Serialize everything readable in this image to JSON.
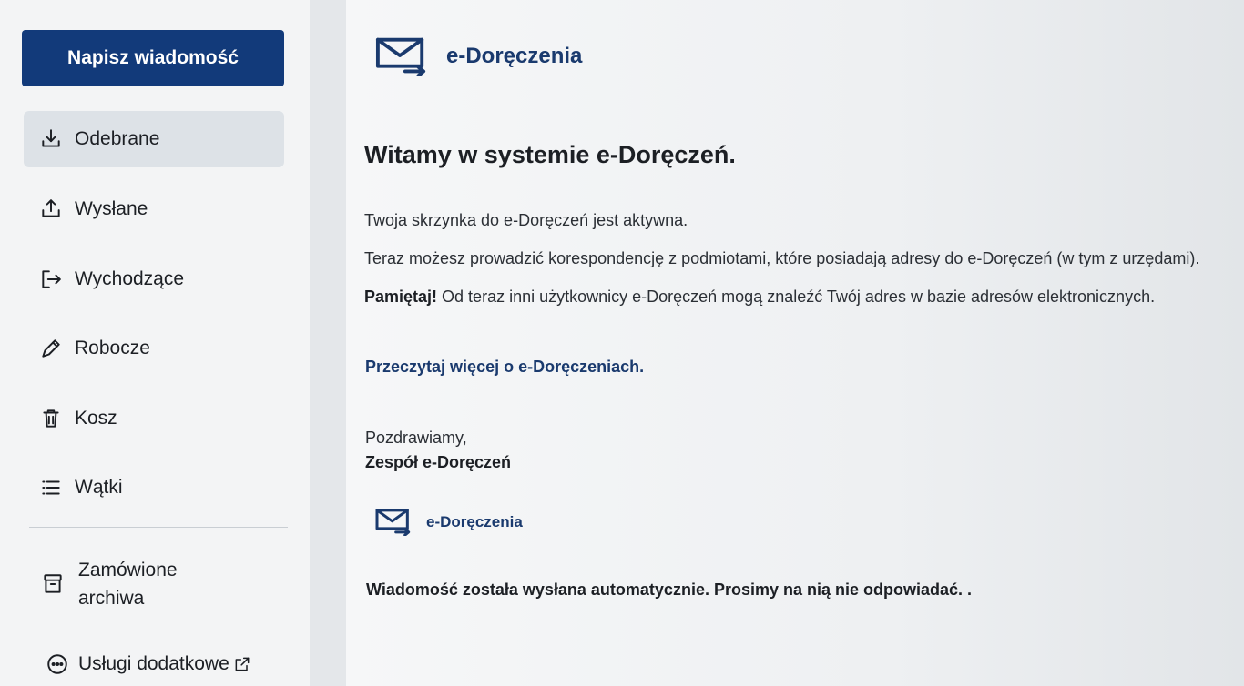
{
  "sidebar": {
    "compose_label": "Napisz wiadomość",
    "items": [
      {
        "label": "Odebrane",
        "icon": "inbox-download-icon",
        "active": true
      },
      {
        "label": "Wysłane",
        "icon": "upload-icon"
      },
      {
        "label": "Wychodzące",
        "icon": "logout-arrow-icon"
      },
      {
        "label": "Robocze",
        "icon": "pencil-icon"
      },
      {
        "label": "Kosz",
        "icon": "trash-icon"
      },
      {
        "label": "Wątki",
        "icon": "list-icon"
      }
    ],
    "archive": {
      "label_line1": "Zamówione",
      "label_line2": "archiwa",
      "icon": "archive-box-icon"
    },
    "extra": {
      "label": "Usługi dodatkowe",
      "icon": "more-circle-icon",
      "external_icon": "external-link-icon"
    }
  },
  "message": {
    "brand": "e-Doręczenia",
    "welcome": "Witamy w systemie e-Doręczeń.",
    "line1": "Twoja skrzynka do e-Doręczeń jest aktywna.",
    "line2": "Teraz możesz prowadzić korespondencję z podmiotami, które posiadają adresy do e-Doręczeń (w tym z urzędami).",
    "line3_bold": "Pamiętaj!",
    "line3_rest": " Od teraz inni użytkownicy e-Doręczeń mogą znaleźć Twój adres w bazie adresów elektronicznych.",
    "link": "Przeczytaj więcej o e-Doręczeniach.",
    "greeting": "Pozdrawiamy,",
    "team": "Zespół e-Doręczeń",
    "brand_small": "e-Doręczenia",
    "auto_note": "Wiadomość została wysłana automatycznie. Prosimy na nią nie odpowiadać. ."
  },
  "colors": {
    "primary": "#123a7a",
    "brand_text": "#1a3a6e",
    "active_item_bg": "#dde2e7"
  }
}
